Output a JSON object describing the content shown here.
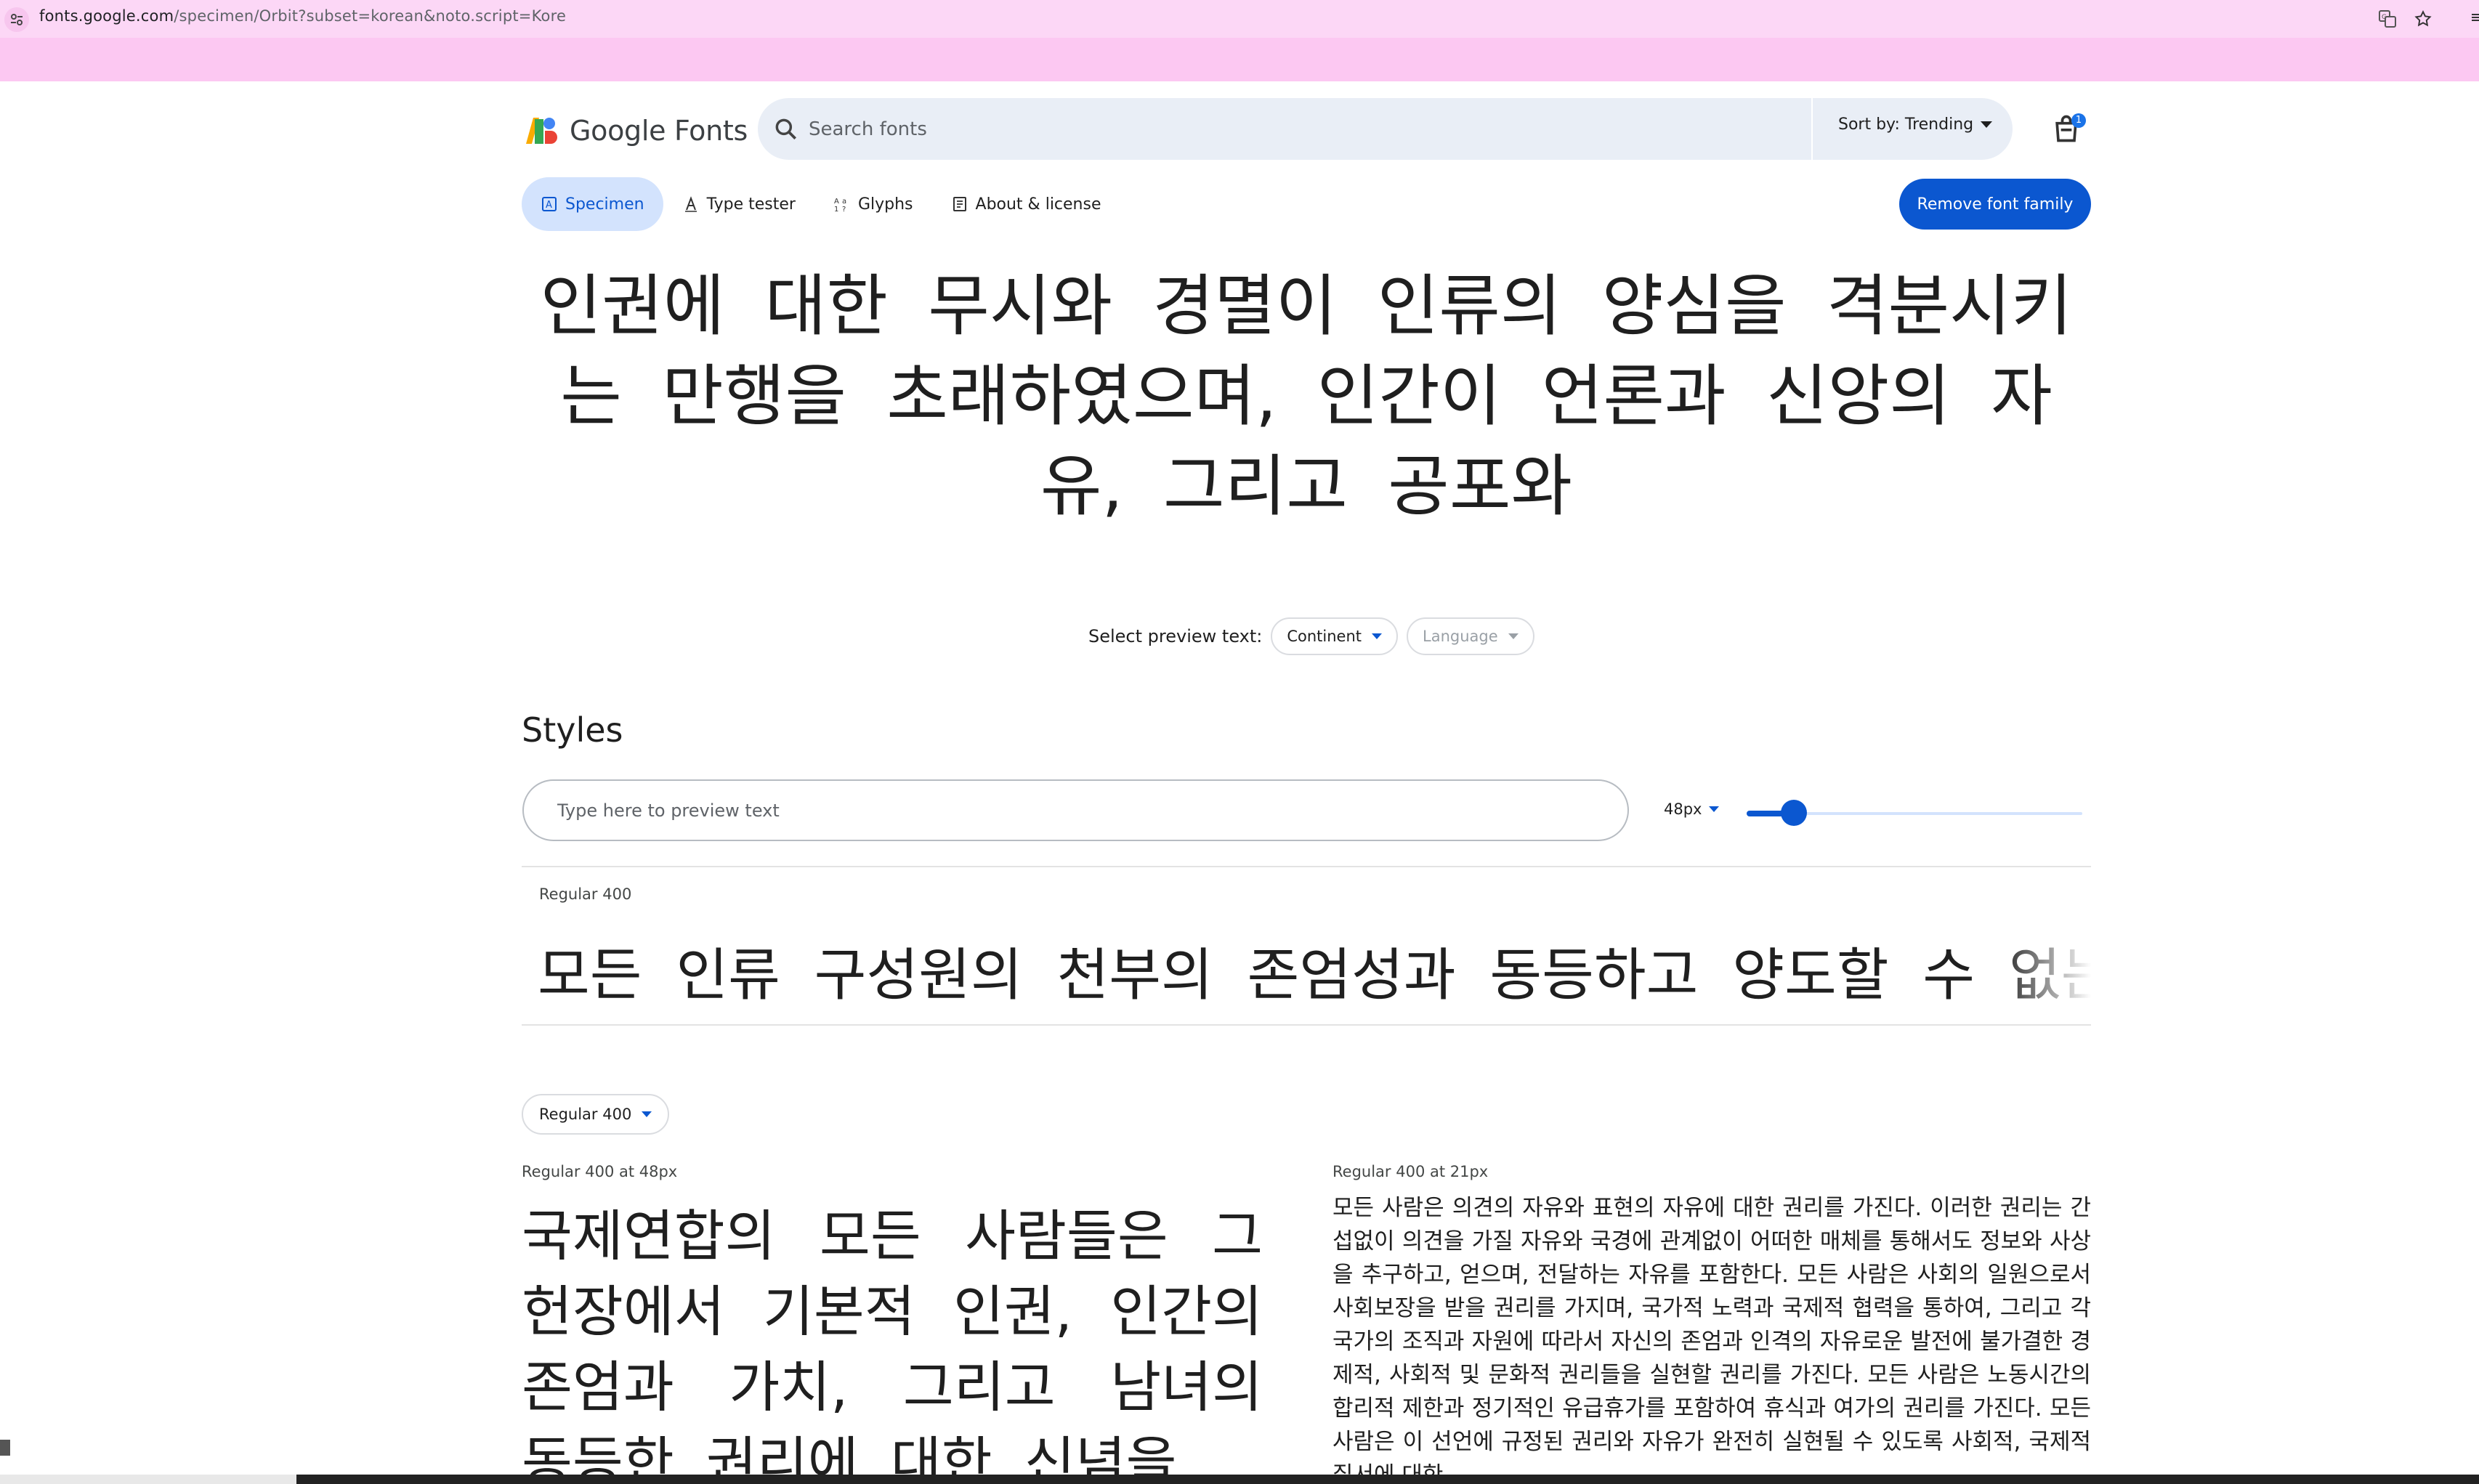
{
  "browser": {
    "url_host": "fonts.google.com",
    "url_path": "/specimen/Orbit?subset=korean&noto.script=Kore"
  },
  "header": {
    "logo_text": "Google Fonts",
    "search_placeholder": "Search fonts",
    "sort_label": "Sort by: Trending",
    "bag_count": "1"
  },
  "tabs": [
    {
      "label": "Specimen",
      "icon": "specimen-icon",
      "active": true
    },
    {
      "label": "Type tester",
      "icon": "type-tester-icon",
      "active": false
    },
    {
      "label": "Glyphs",
      "icon": "glyphs-icon",
      "active": false
    },
    {
      "label": "About & license",
      "icon": "about-icon",
      "active": false
    }
  ],
  "remove_button": "Remove font family",
  "hero_text": "인권에 대한 무시와 경멸이 인류의 양심을 격분시키는 만행을 초래하였으며, 인간이 언론과 신앙의 자유, 그리고 공포와",
  "preview": {
    "label": "Select preview text:",
    "continent": "Continent",
    "language": "Language"
  },
  "styles": {
    "title": "Styles",
    "input_placeholder": "Type here to preview text",
    "size_label": "48px",
    "slider_fraction": 0.14,
    "style_name": "Regular 400",
    "sample": "모든 인류 구성원의 천부의 존엄성과 동등하고 양도할 수 없는 권리"
  },
  "paragraphs": {
    "weight_select": "Regular 400",
    "left_label": "Regular 400 at 48px",
    "left_text": "국제연합의 모든 사람들은 그 헌장에서 기본적 인권, 인간의 존엄과 가치, 그리고 남녀의 동등한 권리에 대한 신념을",
    "right_label": "Regular 400 at 21px",
    "right_text": "모든 사람은 의견의 자유와 표현의 자유에 대한 권리를 가진다. 이러한 권리는 간섭없이 의견을 가질 자유와 국경에 관계없이 어떠한 매체를 통해서도 정보와 사상을 추구하고, 얻으며, 전달하는 자유를 포함한다. 모든 사람은 사회의 일원으로서 사회보장을 받을 권리를 가지며, 국가적 노력과 국제적 협력을 통하여, 그리고 각 국가의 조직과 자원에 따라서 자신의 존엄과 인격의 자유로운 발전에 불가결한 경제적, 사회적 및 문화적 권리들을 실현할 권리를 가진다. 모든 사람은 노동시간의 합리적 제한과 정기적인 유급휴가를 포함하여 휴식과 여가의 권리를 가진다. 모든 사람은 이 선언에 규정된 권리와 자유가 완전히 실현될 수 있도록 사회적, 국제적 질서에 대한"
  },
  "colors": {
    "accent": "#0b57d0",
    "tab_active_bg": "#d3e3fd",
    "url_bar": "#fcd7f6",
    "band": "#fcc8f2"
  }
}
